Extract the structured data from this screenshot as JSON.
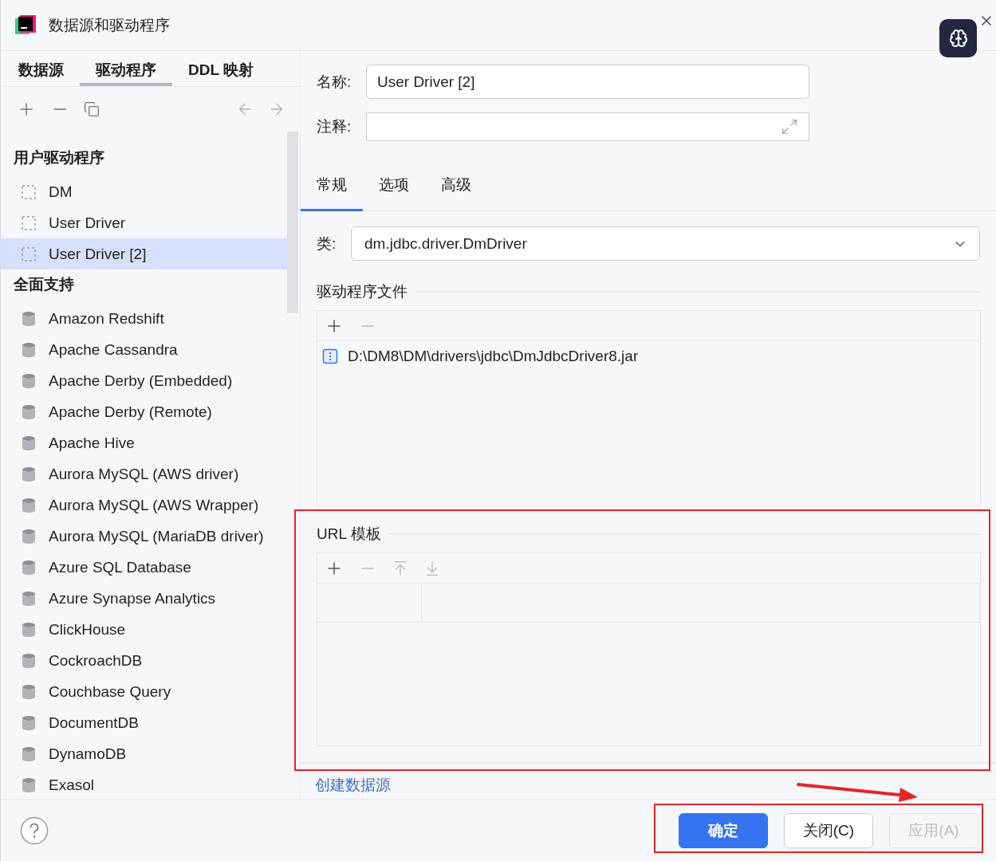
{
  "window": {
    "title": "数据源和驱动程序"
  },
  "nav_tabs": [
    {
      "label": "数据源",
      "selected": false
    },
    {
      "label": "驱动程序",
      "selected": true
    },
    {
      "label": "DDL 映射",
      "selected": false
    }
  ],
  "driver_groups": [
    {
      "kind": "user",
      "title": "用户驱动程序",
      "items": [
        {
          "label": "DM",
          "selected": false
        },
        {
          "label": "User Driver",
          "selected": false
        },
        {
          "label": "User Driver [2]",
          "selected": true
        }
      ]
    },
    {
      "kind": "builtin",
      "title": "全面支持",
      "items": [
        {
          "label": "Amazon Redshift",
          "selected": false
        },
        {
          "label": "Apache Cassandra",
          "selected": false
        },
        {
          "label": "Apache Derby (Embedded)",
          "selected": false
        },
        {
          "label": "Apache Derby (Remote)",
          "selected": false
        },
        {
          "label": "Apache Hive",
          "selected": false
        },
        {
          "label": "Aurora MySQL (AWS driver)",
          "selected": false
        },
        {
          "label": "Aurora MySQL (AWS Wrapper)",
          "selected": false
        },
        {
          "label": "Aurora MySQL (MariaDB driver)",
          "selected": false
        },
        {
          "label": "Azure SQL Database",
          "selected": false
        },
        {
          "label": "Azure Synapse Analytics",
          "selected": false
        },
        {
          "label": "ClickHouse",
          "selected": false
        },
        {
          "label": "CockroachDB",
          "selected": false
        },
        {
          "label": "Couchbase Query",
          "selected": false
        },
        {
          "label": "DocumentDB",
          "selected": false
        },
        {
          "label": "DynamoDB",
          "selected": false
        },
        {
          "label": "Exasol",
          "selected": false
        }
      ]
    }
  ],
  "form": {
    "name_label": "名称:",
    "name_value": "User Driver [2]",
    "comment_label": "注释:"
  },
  "detail_tabs": [
    {
      "label": "常规",
      "selected": true
    },
    {
      "label": "选项",
      "selected": false
    },
    {
      "label": "高级",
      "selected": false
    }
  ],
  "driver_class": {
    "label": "类:",
    "value": "dm.jdbc.driver.DmDriver"
  },
  "driver_files": {
    "title": "驱动程序文件",
    "files": [
      "D:\\DM8\\DM\\drivers\\jdbc\\DmJdbcDriver8.jar"
    ]
  },
  "url_templates": {
    "title": "URL 模板"
  },
  "create_link": "创建数据源",
  "buttons": [
    {
      "label": "确定",
      "kind": "primary",
      "disabled": false
    },
    {
      "label": "关闭(C)",
      "kind": "secondary",
      "disabled": false
    },
    {
      "label": "应用(A)",
      "kind": "secondary",
      "disabled": true
    }
  ]
}
